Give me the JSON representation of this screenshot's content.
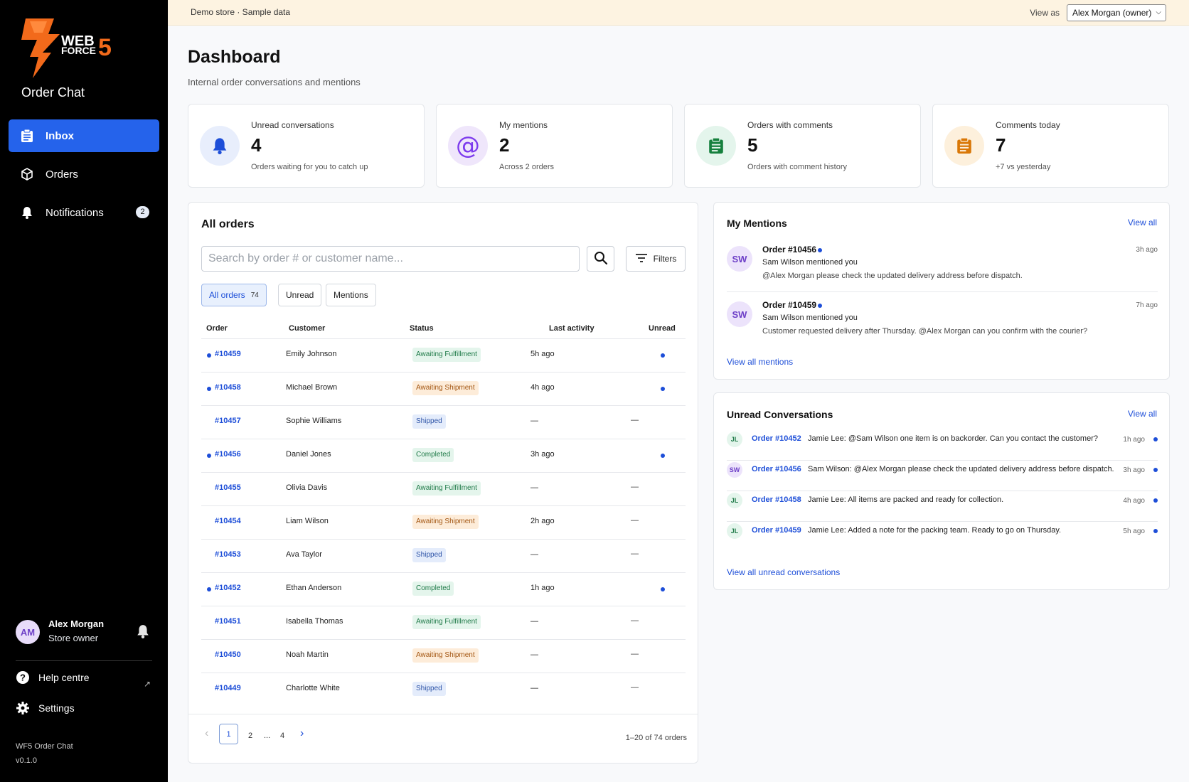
{
  "brand": {
    "logo_text_top": "WEB",
    "logo_text_bottom": "FORCE",
    "logo_number": "5",
    "app_title": "Order Chat"
  },
  "nav": [
    {
      "label": "Inbox",
      "icon": "clipboard-icon",
      "active": true
    },
    {
      "label": "Orders",
      "icon": "box-icon",
      "active": false
    },
    {
      "label": "Notifications",
      "icon": "bell-icon",
      "badge": "2",
      "active": false
    }
  ],
  "user": {
    "initials": "AM",
    "name": "Alex Morgan",
    "role": "Store owner"
  },
  "side_links": {
    "help": "Help centre",
    "help_ext": "↗",
    "settings": "Settings"
  },
  "app_version": {
    "name": "WF5 Order Chat",
    "version": "v0.1.0"
  },
  "topbar": {
    "store_label": "Demo store · Sample data",
    "view_as_label": "View as",
    "view_as_value": "Alex Morgan (owner)"
  },
  "page": {
    "title": "Dashboard",
    "subtitle": "Internal order conversations and mentions"
  },
  "stats": [
    {
      "label": "Unread conversations",
      "value": "4",
      "hint": "Orders waiting for you to catch up",
      "icon": "bell-icon",
      "bg": "#e8eefc",
      "fg": "#1d4ed8"
    },
    {
      "label": "My mentions",
      "value": "2",
      "hint": "Across 2 orders",
      "icon": "at-icon",
      "bg": "#efe6fb",
      "fg": "#7c3aed"
    },
    {
      "label": "Orders with comments",
      "value": "5",
      "hint": "Orders with comment history",
      "icon": "clipboard-icon",
      "bg": "#e4f5ec",
      "fg": "#15803d"
    },
    {
      "label": "Comments today",
      "value": "7",
      "hint": "+7 vs yesterday",
      "icon": "clipboard-icon",
      "bg": "#fdf0dc",
      "fg": "#d97706"
    }
  ],
  "orders": {
    "title": "All orders",
    "search_placeholder": "Search by order # or customer name...",
    "filters_label": "Filters",
    "tabs": [
      {
        "label": "All orders",
        "count": "74",
        "active": true
      },
      {
        "label": "Unread",
        "count": "",
        "active": false
      },
      {
        "label": "Mentions",
        "count": "",
        "active": false
      }
    ],
    "columns": [
      "Order",
      "Customer",
      "Status",
      "Last activity",
      "Unread"
    ],
    "rows": [
      {
        "order": "#10459",
        "customer": "Emily Johnson",
        "status": "Awaiting Fulfillment",
        "status_color": "green",
        "activity": "5h ago",
        "unread": true
      },
      {
        "order": "#10458",
        "customer": "Michael Brown",
        "status": "Awaiting Shipment",
        "status_color": "orange",
        "activity": "4h ago",
        "unread": true
      },
      {
        "order": "#10457",
        "customer": "Sophie Williams",
        "status": "Shipped",
        "status_color": "blue",
        "activity": "—",
        "unread": false
      },
      {
        "order": "#10456",
        "customer": "Daniel Jones",
        "status": "Completed",
        "status_color": "green",
        "activity": "3h ago",
        "unread": true
      },
      {
        "order": "#10455",
        "customer": "Olivia Davis",
        "status": "Awaiting Fulfillment",
        "status_color": "green",
        "activity": "—",
        "unread": false
      },
      {
        "order": "#10454",
        "customer": "Liam Wilson",
        "status": "Awaiting Shipment",
        "status_color": "orange",
        "activity": "2h ago",
        "unread": false
      },
      {
        "order": "#10453",
        "customer": "Ava Taylor",
        "status": "Shipped",
        "status_color": "blue",
        "activity": "—",
        "unread": false
      },
      {
        "order": "#10452",
        "customer": "Ethan Anderson",
        "status": "Completed",
        "status_color": "green",
        "activity": "1h ago",
        "unread": true
      },
      {
        "order": "#10451",
        "customer": "Isabella Thomas",
        "status": "Awaiting Fulfillment",
        "status_color": "green",
        "activity": "—",
        "unread": false
      },
      {
        "order": "#10450",
        "customer": "Noah Martin",
        "status": "Awaiting Shipment",
        "status_color": "orange",
        "activity": "—",
        "unread": false
      },
      {
        "order": "#10449",
        "customer": "Charlotte White",
        "status": "Shipped",
        "status_color": "blue",
        "activity": "—",
        "unread": false
      }
    ],
    "empty_marker": "—",
    "pagination": {
      "prev": "‹",
      "pages": [
        "1",
        "2",
        "...",
        "4"
      ],
      "current": "1",
      "next": "›",
      "range": "1–20 of 74 orders"
    }
  },
  "mentions": {
    "title": "My Mentions",
    "view_all": "View all",
    "items": [
      {
        "initials": "SW",
        "order": "Order #10456",
        "who": "Sam Wilson mentioned you",
        "text": "@Alex Morgan please check the updated delivery address before dispatch.",
        "time": "3h ago"
      },
      {
        "initials": "SW",
        "order": "Order #10459",
        "who": "Sam Wilson mentioned you",
        "text": "Customer requested delivery after Thursday. @Alex Morgan can you confirm with the courier?",
        "time": "7h ago"
      }
    ],
    "footer": "View all mentions"
  },
  "unread_conversations": {
    "title": "Unread Conversations",
    "view_all": "View all",
    "items": [
      {
        "initials": "JL",
        "kind": "jl",
        "order": "Order #10452",
        "text": "Jamie Lee: @Sam Wilson one item is on backorder. Can you contact the customer?",
        "time": "1h ago"
      },
      {
        "initials": "SW",
        "kind": "sw",
        "order": "Order #10456",
        "text": "Sam Wilson: @Alex Morgan please check the updated delivery address before dispatch.",
        "time": "3h ago"
      },
      {
        "initials": "JL",
        "kind": "jl",
        "order": "Order #10458",
        "text": "Jamie Lee: All items are packed and ready for collection.",
        "time": "4h ago"
      },
      {
        "initials": "JL",
        "kind": "jl",
        "order": "Order #10459",
        "text": "Jamie Lee: Added a note for the packing team. Ready to go on Thursday.",
        "time": "5h ago"
      }
    ],
    "footer": "View all unread conversations"
  }
}
